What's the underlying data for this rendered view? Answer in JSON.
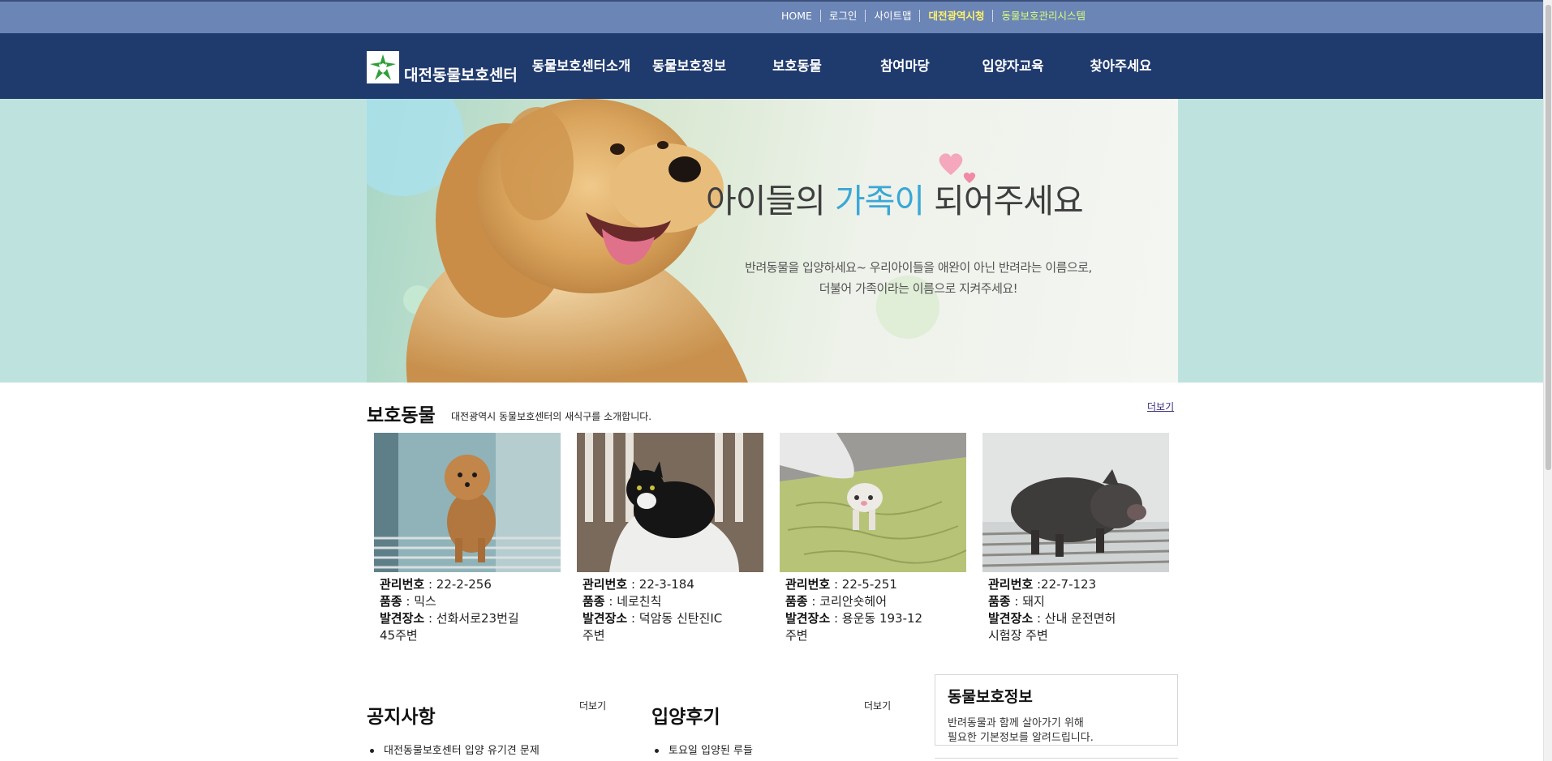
{
  "topbar": {
    "links": [
      "HOME",
      "로그인",
      "사이트맵",
      "대전광역시청",
      "동물보호관리시스템"
    ]
  },
  "header": {
    "site_name": "대전동물보호센터",
    "menu": [
      "동물보호센터소개",
      "동물보호정보",
      "보호동물",
      "참여마당",
      "입양자교육",
      "찾아주세요"
    ]
  },
  "banner": {
    "slogan_part1": "아이들의 ",
    "slogan_accent": "가족이",
    "slogan_part2": " 되어주세요",
    "subtitle_line1": "반려동물을 입양하세요~ 우리아이들을 애완이 아닌 반려라는 이름으로,",
    "subtitle_line2": "더불어 가족이라는 이름으로 지켜주세요!"
  },
  "animals": {
    "title": "보호동물",
    "subtitle": "대전광역시 동물보호센터의 새식구를 소개합니다.",
    "more": "더보기",
    "labels": {
      "id": "관리번호",
      "breed": "품종",
      "place": "발견장소"
    },
    "items": [
      {
        "id": " : 22-2-256",
        "breed": " : 믹스",
        "place_line1": " : 선화서로23번길",
        "place_line2": "45주변"
      },
      {
        "id": " : 22-3-184",
        "breed": " : 네로친칙",
        "place_line1": " : 덕암동 신탄진IC",
        "place_line2": "주변"
      },
      {
        "id": " : 22-5-251",
        "breed": " : 코리안숏헤어",
        "place_line1": " : 용운동 193-12",
        "place_line2": "주변"
      },
      {
        "id": " :22-7-123",
        "breed": " : 돼지",
        "place_line1": " : 산내 운전면허",
        "place_line2": "시험장 주변"
      }
    ]
  },
  "notice": {
    "title": "공지사항",
    "more": "더보기",
    "item": "대전동물보호센터 입양 유기견 문제"
  },
  "review": {
    "title": "입양후기",
    "more": "더보기",
    "item": "토요일 입양된 루들"
  },
  "info_box": {
    "title": "동물보호정보",
    "line1": "반려동물과 함께 살아가기 위해",
    "line2": "필요한 기본정보를 알려드립니다."
  },
  "colors": {
    "topbar": "#6b85b6",
    "navbar": "#1f3a6d",
    "hero_bg": "#bee3de",
    "slogan_accent": "#3aa7d6"
  }
}
